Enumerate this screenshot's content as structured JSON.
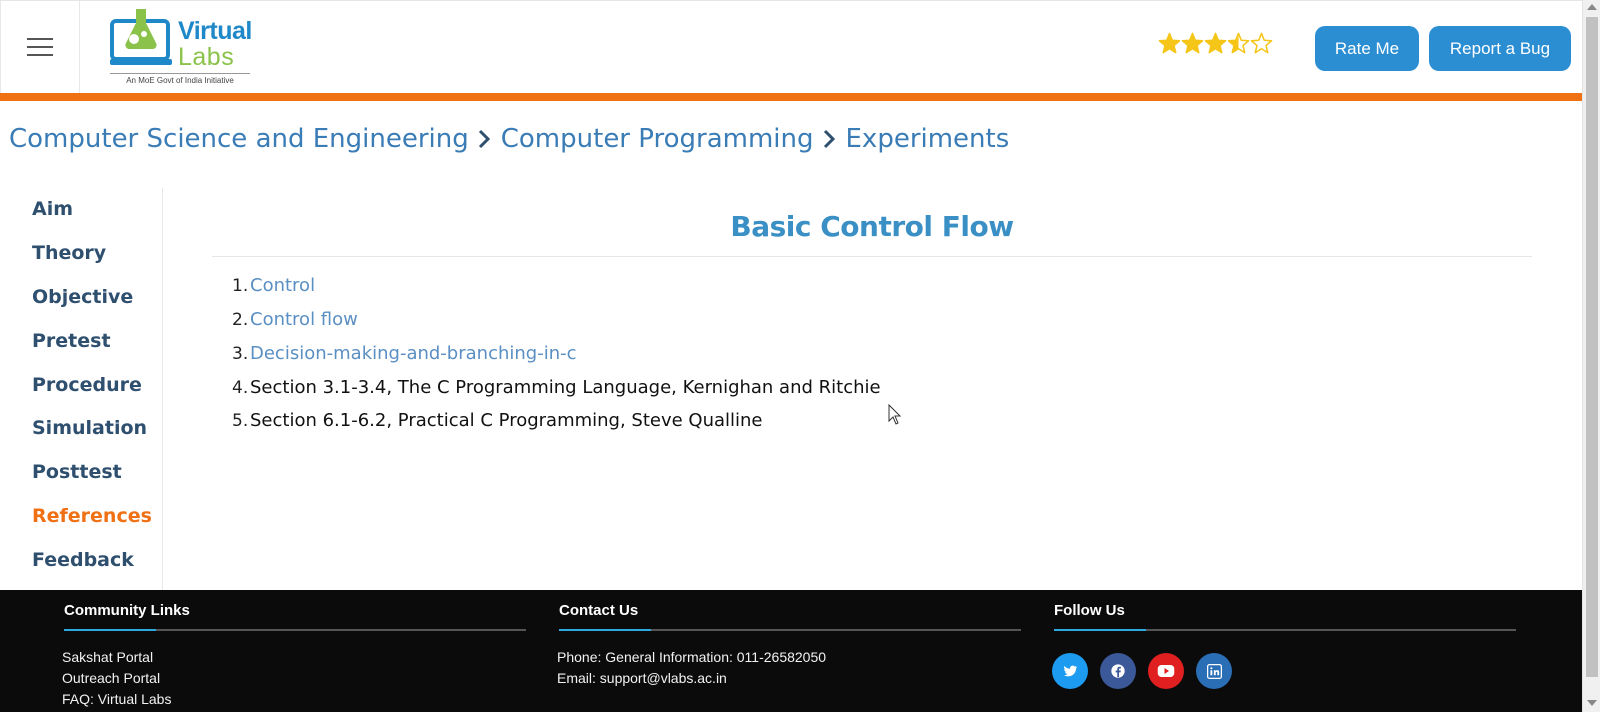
{
  "header": {
    "logo": {
      "word1": "Virtual",
      "word2": "Labs",
      "tagline": "An MoE Govt of India Initiative"
    },
    "rating": {
      "value": 3.5,
      "max": 5,
      "color": "#f5c518"
    },
    "rate_label": "Rate Me",
    "bug_label": "Report a Bug",
    "accent_color": "#f07014",
    "button_color": "#2b8ed3"
  },
  "breadcrumb": {
    "items": [
      "Computer Science and Engineering",
      "Computer Programming",
      "Experiments"
    ]
  },
  "sidebar": {
    "items": [
      {
        "label": "Aim"
      },
      {
        "label": "Theory"
      },
      {
        "label": "Objective"
      },
      {
        "label": "Pretest"
      },
      {
        "label": "Procedure"
      },
      {
        "label": "Simulation"
      },
      {
        "label": "Posttest"
      },
      {
        "label": "References",
        "active": true
      },
      {
        "label": "Feedback"
      }
    ]
  },
  "main": {
    "title": "Basic Control Flow",
    "references": [
      {
        "num": "1.",
        "text": "Control",
        "link": true
      },
      {
        "num": "2.",
        "text": "Control flow",
        "link": true
      },
      {
        "num": "3.",
        "text": "Decision-making-and-branching-in-c",
        "link": true
      },
      {
        "num": "4.",
        "text": "Section 3.1-3.4, The C Programming Language, Kernighan and Ritchie",
        "link": false
      },
      {
        "num": "5.",
        "text": "Section 6.1-6.2, Practical C Programming, Steve Qualline",
        "link": false
      }
    ]
  },
  "footer": {
    "community": {
      "heading": "Community Links",
      "links": [
        "Sakshat Portal",
        "Outreach Portal",
        "FAQ: Virtual Labs"
      ]
    },
    "contact": {
      "heading": "Contact Us",
      "phone": "Phone: General Information: 011-26582050",
      "email": "Email: support@vlabs.ac.in"
    },
    "follow": {
      "heading": "Follow Us",
      "icons": [
        {
          "name": "twitter-icon",
          "color": "#1d9bf0"
        },
        {
          "name": "facebook-icon",
          "color": "#3b5998"
        },
        {
          "name": "youtube-icon",
          "color": "#e02020"
        },
        {
          "name": "linkedin-icon",
          "color": "#2a6fb5"
        }
      ]
    }
  }
}
